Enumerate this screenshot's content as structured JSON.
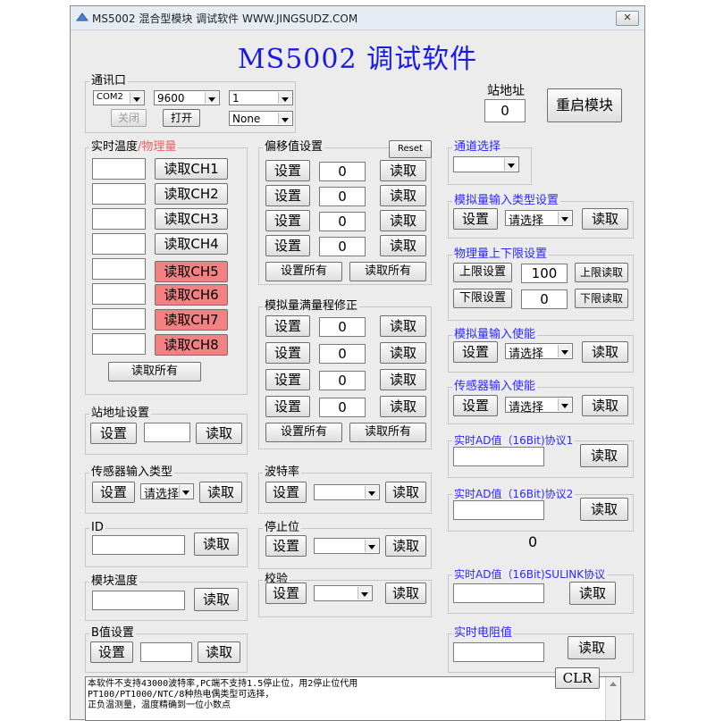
{
  "window": {
    "title": "MS5002 混合型模块 调试软件 WWW.JINGSUDZ.COM",
    "close": "✕"
  },
  "heading": "MS5002 调试软件",
  "comm": {
    "label": "通讯口",
    "port": "COM2",
    "baud": "9600",
    "addr": "1",
    "parity": "None",
    "close_btn": "关闭",
    "open_btn": "打开"
  },
  "station": {
    "label": "站地址",
    "value": "0",
    "restart": "重启模块"
  },
  "realtime": {
    "label_a": "实时温度",
    "label_b": "/物理量",
    "buttons": [
      "读取CH1",
      "读取CH2",
      "读取CH3",
      "读取CH4",
      "读取CH5",
      "读取CH6",
      "读取CH7",
      "读取CH8"
    ],
    "read_all": "读取所有"
  },
  "offset": {
    "label": "偏移值设置",
    "reset": "Reset",
    "set": "设置",
    "read": "读取",
    "values": [
      "0",
      "0",
      "0",
      "0"
    ],
    "set_all": "设置所有",
    "read_all": "读取所有"
  },
  "fullscale": {
    "label": "模拟量满量程修正",
    "set": "设置",
    "read": "读取",
    "values": [
      "0",
      "0",
      "0",
      "0"
    ],
    "set_all": "设置所有",
    "read_all": "读取所有"
  },
  "channel_select": {
    "label": "通道选择"
  },
  "analog_type": {
    "label": "模拟量输入类型设置",
    "set": "设置",
    "select": "请选择",
    "read": "读取"
  },
  "phys_limits": {
    "label": "物理量上下限设置",
    "upper_btn": "上限设置",
    "upper_val": "100",
    "upper_read": "上限读取",
    "lower_btn": "下限设置",
    "lower_val": "0",
    "lower_read": "下限读取"
  },
  "analog_enable": {
    "label": "模拟量输入使能",
    "set": "设置",
    "select": "请选择",
    "read": "读取"
  },
  "sensor_enable": {
    "label": "传感器输入使能",
    "set": "设置",
    "select": "请选择",
    "read": "读取"
  },
  "station_set": {
    "label": "站地址设置",
    "set": "设置",
    "read": "读取"
  },
  "sensor_type": {
    "label": "传感器输入类型",
    "set": "设置",
    "select": "请选择",
    "read": "读取"
  },
  "baud": {
    "label": "波特率",
    "set": "设置",
    "read": "读取"
  },
  "stopbit": {
    "label": "停止位",
    "set": "设置",
    "read": "读取"
  },
  "parity": {
    "label": "校验",
    "set": "设置",
    "read": "读取"
  },
  "id": {
    "label": "ID",
    "read": "读取"
  },
  "module_temp": {
    "label": "模块温度",
    "read": "读取"
  },
  "bvalue": {
    "label": "B值设置",
    "set": "设置",
    "read": "读取"
  },
  "ad1": {
    "label": "实时AD值（16Bit)协议1",
    "read": "读取"
  },
  "ad2": {
    "label": "实时AD值（16Bit)协议2",
    "read": "读取",
    "value": "0"
  },
  "ad_sulink": {
    "label": "实时AD值（16Bit)SULINK协议",
    "read": "读取"
  },
  "resistance": {
    "label": "实时电阻值",
    "read": "读取"
  },
  "status": {
    "lines": "本软件不支持43000波特率,PC端不支持1.5停止位，用2停止位代用\nPT100/PT1000/NTC/8种热电偶类型可选择，\n正负温测量，温度精确到一位小数点",
    "clr": "CLR"
  },
  "colors": {
    "accent_blue": "#1a1ae6",
    "label_blue": "#2a2aff",
    "ch_red": "#f28282"
  }
}
